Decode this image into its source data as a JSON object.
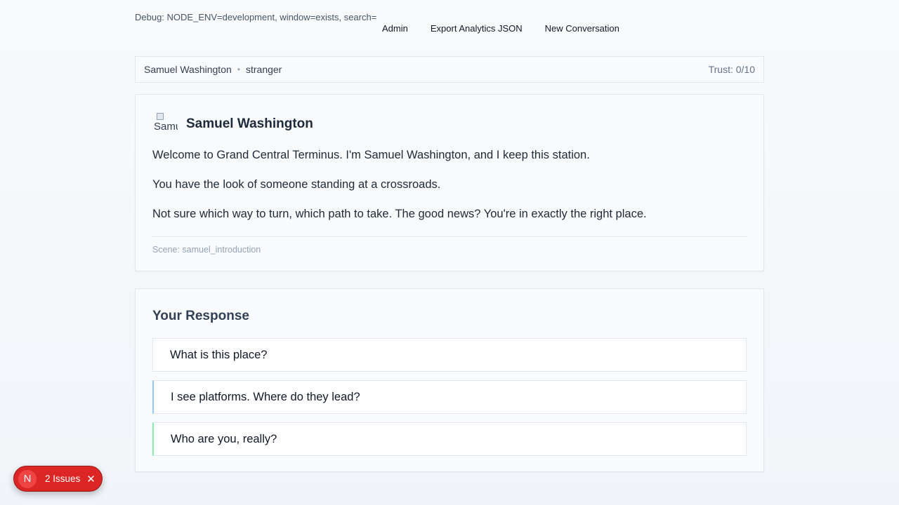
{
  "debug": "Debug: NODE_ENV=development, window=exists, search=",
  "nav": {
    "admin": "Admin",
    "export": "Export Analytics JSON",
    "new_conversation": "New Conversation"
  },
  "status": {
    "character": "Samuel Washington",
    "separator": "•",
    "relationship": "stranger",
    "trust": "Trust: 0/10"
  },
  "dialogue": {
    "avatar_alt": "Samuel",
    "speaker": "Samuel Washington",
    "lines": [
      "Welcome to Grand Central Terminus. I'm Samuel Washington, and I keep this station.",
      "You have the look of someone standing at a crossroads.",
      "Not sure which way to turn, which path to take. The good news? You're in exactly the right place."
    ],
    "scene": "Scene: samuel_introduction"
  },
  "response": {
    "title": "Your Response",
    "choices": [
      "What is this place?",
      "I see platforms. Where do they lead?",
      "Who are you, really?"
    ]
  },
  "issues_badge": {
    "icon": "N",
    "label": "2 Issues",
    "close": "✕"
  },
  "colors": {
    "accent_blue": "#93c5fd",
    "accent_green": "#86efac",
    "issues_red": "#dc2626"
  }
}
